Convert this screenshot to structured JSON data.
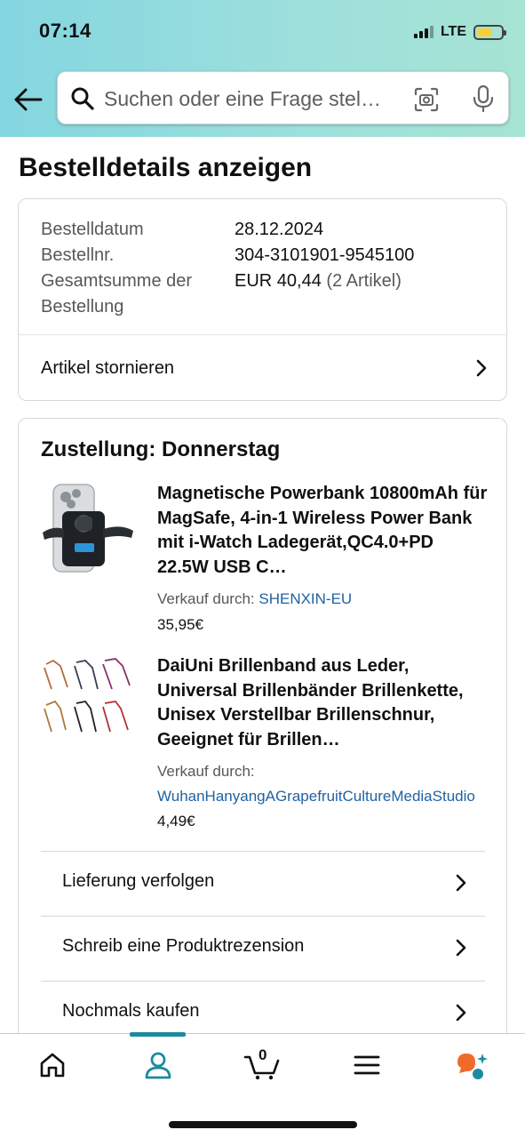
{
  "status_bar": {
    "time": "07:14",
    "network": "LTE",
    "battery_level": 0.6,
    "battery_color": "#f7d038"
  },
  "header": {
    "back_icon": "back-arrow-icon",
    "search_placeholder": "Suchen oder eine Frage stel…",
    "camera_icon": "camera-scan-icon",
    "mic_icon": "microphone-icon"
  },
  "page": {
    "title": "Bestelldetails anzeigen"
  },
  "order_summary": {
    "date_label": "Bestelldatum",
    "date_value": "28.12.2024",
    "number_label": "Bestellnr.",
    "number_value": "304-3101901-9545100",
    "total_label_line1": "Gesamtsumme der",
    "total_label_line2": "Bestellung",
    "total_value": "EUR 40,44",
    "total_count": "(2 Artikel)",
    "cancel_label": "Artikel stornieren"
  },
  "delivery": {
    "title": "Zustellung: Donnerstag",
    "items": [
      {
        "title": "Magnetische Powerbank 10800mAh für MagSafe, 4-in-1 Wireless Power Bank mit i-Watch Ladegerät,QC4.0+PD 22.5W USB C…",
        "seller_prefix": "Verkauf durch:",
        "seller": "SHENXIN-EU",
        "price": "35,95€",
        "image": "powerbank-product-image"
      },
      {
        "title": "DaiUni Brillenband aus Leder, Universal Brillenbänder Brillenkette, Unisex Verstellbar Brillenschnur, Geeignet für Brillen…",
        "seller_prefix": "Verkauf durch:",
        "seller": "WuhanHanyangAGrapefruitCultureMediaStudio",
        "price": "4,49€",
        "image": "glasses-strap-product-image"
      }
    ],
    "actions": [
      {
        "label": "Lieferung verfolgen"
      },
      {
        "label": "Schreib eine Produktrezension"
      },
      {
        "label": "Nochmals kaufen"
      }
    ]
  },
  "bottom_nav": {
    "items": [
      "home-icon",
      "account-icon",
      "cart-icon",
      "menu-icon",
      "rufus-chat-icon"
    ],
    "active": "account-icon",
    "cart_count": "0",
    "accent_color": "#1b8ba0"
  }
}
